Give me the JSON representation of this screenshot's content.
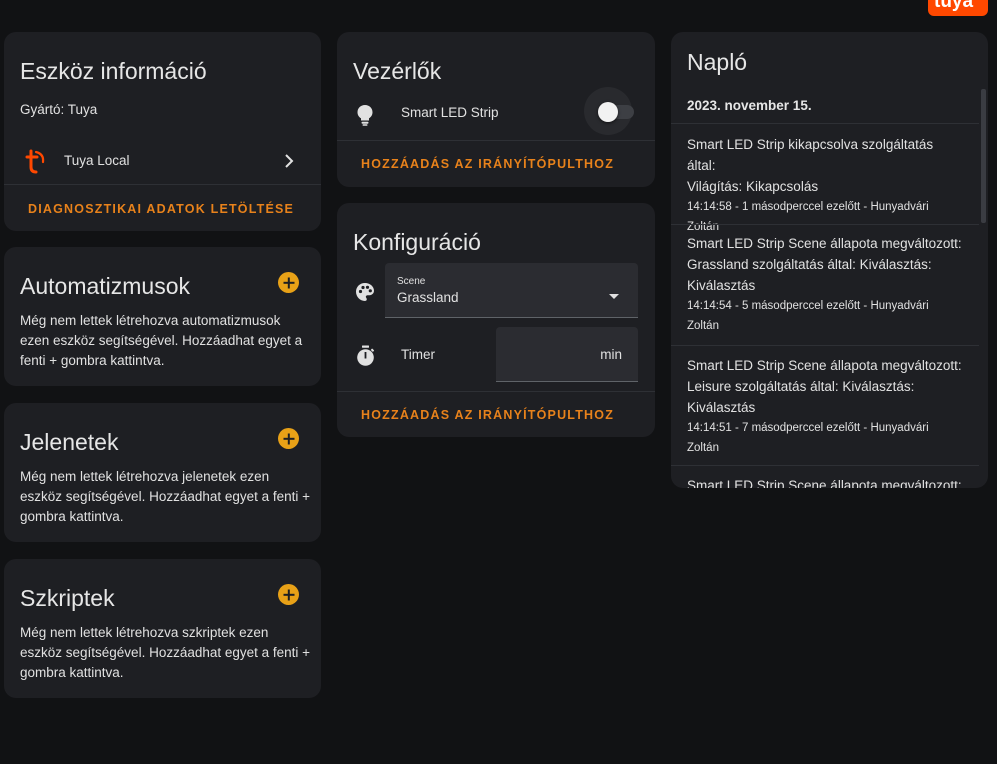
{
  "brand_logo_text": "tuya",
  "device_info": {
    "title": "Eszköz információ",
    "manufacturer": "Gyártó: Tuya",
    "integration_name": "Tuya Local",
    "action_label": "DIAGNOSZTIKAI ADATOK LETÖLTÉSE"
  },
  "automations": {
    "title": "Automatizmusok",
    "text": "Még nem lettek létrehozva automatizmusok ezen eszköz segítségével. Hozzáadhat egyet a fenti + gombra kattintva."
  },
  "scenes": {
    "title": "Jelenetek",
    "text": "Még nem lettek létrehozva jelenetek ezen eszköz segítségével. Hozzáadhat egyet a fenti + gombra kattintva."
  },
  "scripts": {
    "title": "Szkriptek",
    "text": "Még nem lettek létrehozva szkriptek ezen eszköz segítségével. Hozzáadhat egyet a fenti + gombra kattintva."
  },
  "controls": {
    "title": "Vezérlők",
    "entity_name": "Smart LED Strip",
    "toggle_state": "off",
    "action_label": "HOZZÁADÁS AZ IRÁNYÍTÓPULTHOZ"
  },
  "configuration": {
    "title": "Konfiguráció",
    "scene_label": "Scene",
    "scene_value": "Grassland",
    "timer_label": "Timer",
    "timer_unit": "min",
    "action_label": "HOZZÁADÁS AZ IRÁNYÍTÓPULTHOZ"
  },
  "logbook": {
    "title": "Napló",
    "date": "2023. november 15.",
    "entries": [
      {
        "line1": "Smart LED Strip kikapcsolva szolgáltatás által:",
        "line2": "Világítás: Kikapcsolás",
        "line3": "",
        "meta1": "14:14:58 - 1 másodperccel ezelőtt - Hunyadvári",
        "meta2": "Zoltán"
      },
      {
        "line1": "Smart LED Strip Scene állapota megváltozott:",
        "line2": "Grassland szolgáltatás által: Kiválasztás:",
        "line3": "Kiválasztás",
        "meta1": "14:14:54 - 5 másodperccel ezelőtt - Hunyadvári",
        "meta2": "Zoltán"
      },
      {
        "line1": "Smart LED Strip Scene állapota megváltozott:",
        "line2": "Leisure szolgáltatás által: Kiválasztás:",
        "line3": "Kiválasztás",
        "meta1": "14:14:51 - 7 másodperccel ezelőtt - Hunyadvári",
        "meta2": "Zoltán"
      },
      {
        "line1": "Smart LED Strip Scene állapota megváltozott:"
      }
    ]
  },
  "colors": {
    "accent_orange": "#e8821b",
    "plus_button": "#e8a117",
    "card_bg": "#1e1f23",
    "page_bg": "#111214"
  },
  "icons": {
    "integration": "tuya-logo-icon",
    "chevron": "chevron-right-icon",
    "bulb": "lightbulb-icon",
    "palette": "palette-icon",
    "timer": "timer-icon",
    "dropdown": "caret-down-icon",
    "add": "plus-circle-icon"
  }
}
